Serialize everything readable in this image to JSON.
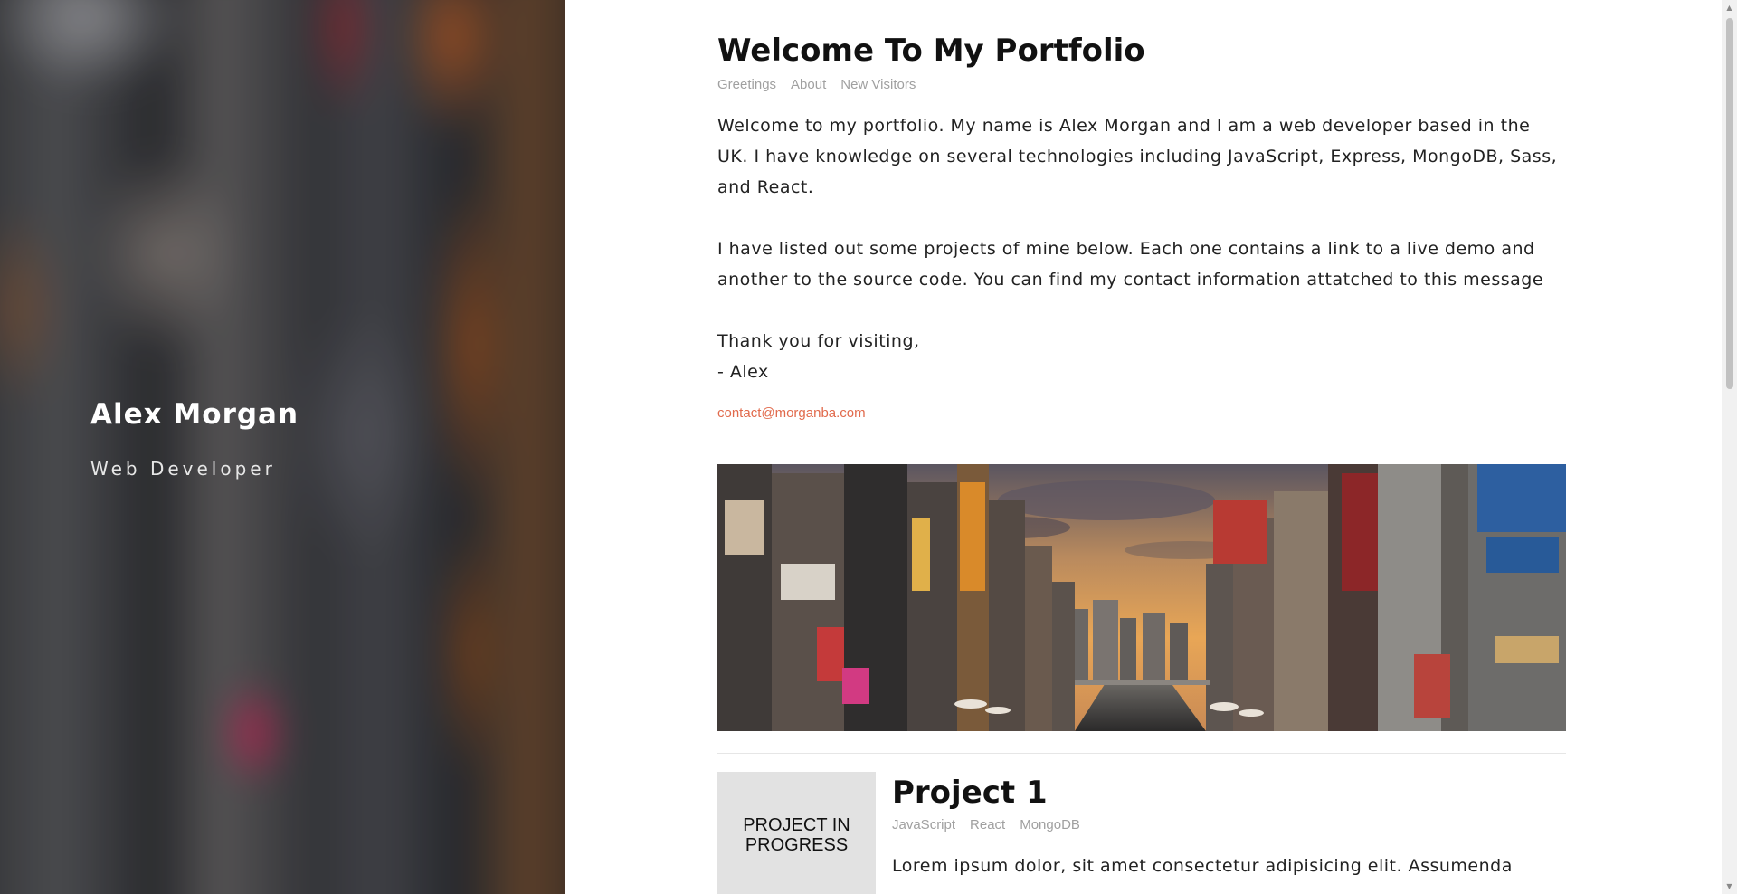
{
  "hero": {
    "name": "Alex Morgan",
    "role": "Web Developer"
  },
  "intro": {
    "title": "Welcome To My Portfolio",
    "tags": [
      "Greetings",
      "About",
      "New Visitors"
    ],
    "paragraphs": [
      "Welcome to my portfolio. My name is Alex Morgan and I am a web developer based in the UK. I have knowledge on several technologies including JavaScript, Express, MongoDB, Sass, and React.",
      "I have listed out some projects of mine below. Each one contains a link to a live demo and another to the source code. You can find my contact information attatched to this message"
    ],
    "signoff": "Thank you for visiting,",
    "signature": "- Alex",
    "email": "contact@morganba.com"
  },
  "project": {
    "thumb_label": "PROJECT IN PROGRESS",
    "title": "Project 1",
    "tags": [
      "JavaScript",
      "React",
      "MongoDB"
    ],
    "description": "Lorem ipsum dolor, sit amet consectetur adipisicing elit. Assumenda"
  },
  "colors": {
    "accent": "#e16a4c",
    "tag": "#a0a0a0",
    "thumb_bg": "#e2e2e2"
  },
  "icons": {
    "scroll_up": "triangle-up",
    "scroll_down": "triangle-down"
  }
}
